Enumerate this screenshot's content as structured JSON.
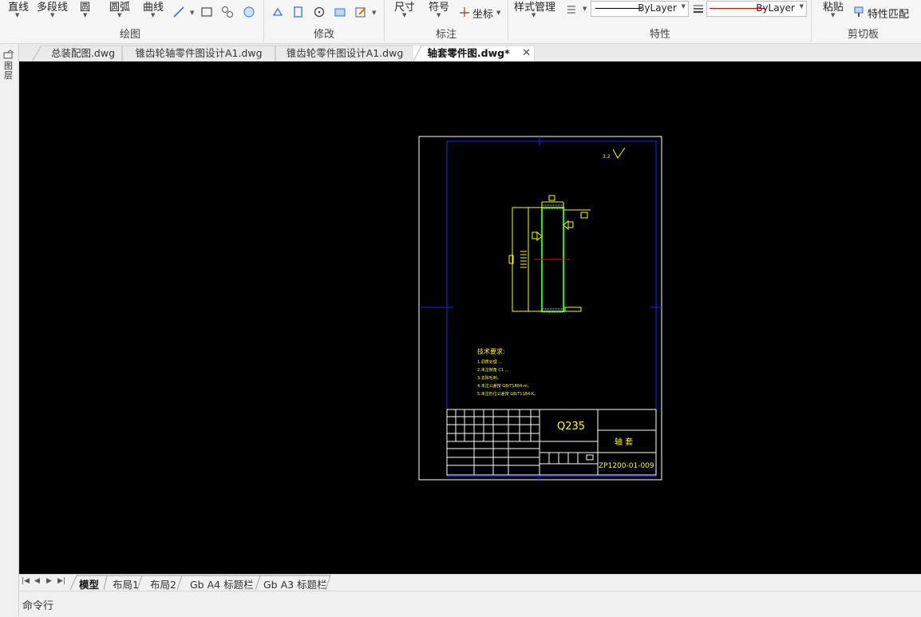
{
  "ribbon": {
    "draw": {
      "items": [
        "直线",
        "多段线",
        "圆",
        "圆弧",
        "曲线"
      ],
      "label": "绘图"
    },
    "modify": {
      "label": "修改"
    },
    "annotate": {
      "items": [
        "尺寸",
        "符号",
        "坐标"
      ],
      "label": "标注"
    },
    "properties": {
      "style_manager": "样式管理",
      "linetype": "ByLayer",
      "lineweight": "ByLayer",
      "label": "特性"
    },
    "clipboard": {
      "paste": "粘贴",
      "match_props": "特性匹配",
      "label": "剪切板"
    }
  },
  "left_panel": {
    "title": "图层"
  },
  "file_tabs": [
    {
      "label": "总装配图.dwg"
    },
    {
      "label": "锥齿轮轴零件图设计A1.dwg"
    },
    {
      "label": "锥齿轮零件图设计A1.dwg"
    },
    {
      "label": "轴套零件图.dwg*"
    }
  ],
  "drawing": {
    "surface_mark": "3.2",
    "tech_req_title": "技术要求:",
    "tech_req_items": [
      "1.调质处理 ...",
      "2.未注倒角 C1 ...",
      "3.去除毛刺。",
      "4.未注公差按 GB/T1804-m。",
      "5.未注形位公差按 GB/T1184-K。"
    ],
    "title_block": {
      "material": "Q235",
      "part_name": "轴 套",
      "drawing_number": "ZP1200-01-009"
    },
    "colors": {
      "background": "#000000",
      "frame": "#ffffff",
      "border": "#0000ff",
      "annotation": "#ffff00",
      "part_outline": "#00ff00",
      "center_line": "#ff0000"
    }
  },
  "layout_tabs": [
    {
      "label": "模型",
      "active": true
    },
    {
      "label": "布局1"
    },
    {
      "label": "布局2"
    },
    {
      "label": "Gb A4 标题栏"
    },
    {
      "label": "Gb A3 标题栏"
    }
  ],
  "command_line": {
    "label": "命令行"
  }
}
